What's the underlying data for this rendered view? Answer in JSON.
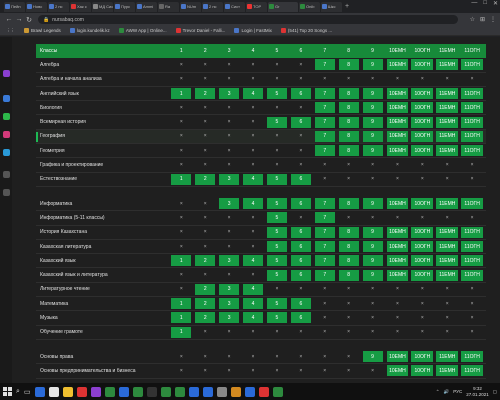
{
  "browser": {
    "tabs": [
      {
        "label": "Пейн",
        "color": "#4a76c8"
      },
      {
        "label": "Новс",
        "color": "#4a76c8"
      },
      {
        "label": "2 нс",
        "color": "#4a76c8"
      },
      {
        "label": "Хак с",
        "color": "#d33"
      },
      {
        "label": "МД Сист",
        "color": "#888"
      },
      {
        "label": "Пурс",
        "color": "#4a76c8"
      },
      {
        "label": "Ammi",
        "color": "#4a76c8"
      },
      {
        "label": "Ra",
        "color": "#666"
      },
      {
        "label": "NUm",
        "color": "#4a76c8"
      },
      {
        "label": "2 нс",
        "color": "#4a76c8"
      },
      {
        "label": "Сист",
        "color": "#4a76c8"
      },
      {
        "label": "TOP",
        "color": "#e33"
      },
      {
        "label": "Gr",
        "color": "#2d8a3e"
      },
      {
        "label": "Onib",
        "color": "#2d8a3e"
      },
      {
        "label": "Шкс",
        "color": "#4a76c8"
      }
    ],
    "active_tab": 12,
    "url": "nursabaq.com",
    "bookmarks": [
      {
        "label": "Brawl Legends",
        "color": "#c93"
      },
      {
        "label": "login.kundelik.kz",
        "color": "#4a76c8"
      },
      {
        "label": "AWW App | Online...",
        "color": "#2d8a3e"
      },
      {
        "label": "Trevor Daniel - Falli...",
        "color": "#d33"
      },
      {
        "label": "Login | FastMix",
        "color": "#4a76c8"
      },
      {
        "label": "(541) Top 20 Songs ...",
        "color": "#d33"
      }
    ]
  },
  "table": {
    "header": {
      "label": "Классы",
      "cols": [
        "1",
        "2",
        "3",
        "4",
        "5",
        "6",
        "7",
        "8",
        "9",
        "10ЕМН",
        "10ОГН",
        "11ЕМН",
        "11ОГН"
      ]
    },
    "groups": [
      {
        "rows": [
          {
            "label": "Алгебра",
            "cells": [
              "×",
              "×",
              "×",
              "×",
              "×",
              "×",
              "7",
              "8",
              "9",
              "10ЕМН",
              "10ОГН",
              "11ЕМН",
              "11ОГН"
            ]
          },
          {
            "label": "Алгебра и начала анализа",
            "cells": [
              "×",
              "×",
              "×",
              "×",
              "×",
              "×",
              "×",
              "×",
              "×",
              "×",
              "×",
              "×",
              "×"
            ]
          },
          {
            "label": "Английский язык",
            "cells": [
              "1",
              "2",
              "3",
              "4",
              "5",
              "6",
              "7",
              "8",
              "9",
              "10ЕМН",
              "10ОГН",
              "11ЕМН",
              "11ОГН"
            ]
          },
          {
            "label": "Биология",
            "cells": [
              "×",
              "×",
              "×",
              "×",
              "×",
              "×",
              "7",
              "8",
              "9",
              "10ЕМН",
              "10ОГН",
              "11ЕМН",
              "11ОГН"
            ]
          },
          {
            "label": "Всемирная история",
            "cells": [
              "×",
              "×",
              "×",
              "×",
              "5",
              "6",
              "7",
              "8",
              "9",
              "10ЕМН",
              "10ОГН",
              "11ЕМН",
              "11ОГН"
            ]
          },
          {
            "label": "География",
            "cells": [
              "×",
              "×",
              "×",
              "×",
              "×",
              "×",
              "7",
              "8",
              "9",
              "10ЕМН",
              "10ОГН",
              "11ЕМН",
              "11ОГН"
            ]
          },
          {
            "label": "Геометрия",
            "cells": [
              "×",
              "×",
              "×",
              "×",
              "×",
              "×",
              "7",
              "8",
              "9",
              "10ЕМН",
              "10ОГН",
              "11ЕМН",
              "11ОГН"
            ]
          },
          {
            "label": "Графика и проектирование",
            "cells": [
              "×",
              "×",
              "×",
              "×",
              "×",
              "×",
              "×",
              "×",
              "×",
              "×",
              "×",
              "×",
              "×"
            ]
          },
          {
            "label": "Естествознание",
            "cells": [
              "1",
              "2",
              "3",
              "4",
              "5",
              "6",
              "×",
              "×",
              "×",
              "×",
              "×",
              "×",
              "×"
            ]
          }
        ]
      },
      {
        "rows": [
          {
            "label": "Информатика",
            "cells": [
              "×",
              "×",
              "3",
              "4",
              "5",
              "6",
              "7",
              "8",
              "9",
              "10ЕМН",
              "10ОГН",
              "11ЕМН",
              "11ОГН"
            ]
          },
          {
            "label": "Информатика (5-11 классы)",
            "cells": [
              "×",
              "×",
              "×",
              "×",
              "5",
              "×",
              "7",
              "×",
              "×",
              "×",
              "×",
              "×",
              "×"
            ]
          },
          {
            "label": "История Казахстана",
            "cells": [
              "×",
              "×",
              "×",
              "×",
              "5",
              "6",
              "7",
              "8",
              "9",
              "10ЕМН",
              "10ОГН",
              "11ЕМН",
              "11ОГН"
            ]
          },
          {
            "label": "Казахская литература",
            "cells": [
              "×",
              "×",
              "×",
              "×",
              "5",
              "6",
              "7",
              "8",
              "9",
              "10ЕМН",
              "10ОГН",
              "11ЕМН",
              "11ОГН"
            ]
          },
          {
            "label": "Казахский язык",
            "cells": [
              "1",
              "2",
              "3",
              "4",
              "5",
              "6",
              "7",
              "8",
              "9",
              "10ЕМН",
              "10ОГН",
              "11ЕМН",
              "11ОГН"
            ]
          },
          {
            "label": "Казахский язык и литература",
            "cells": [
              "×",
              "×",
              "×",
              "×",
              "5",
              "6",
              "7",
              "8",
              "9",
              "10ЕМН",
              "10ОГН",
              "11ЕМН",
              "11ОГН"
            ]
          },
          {
            "label": "Литературное чтение",
            "cells": [
              "×",
              "2",
              "3",
              "4",
              "×",
              "×",
              "×",
              "×",
              "×",
              "×",
              "×",
              "×",
              "×"
            ]
          },
          {
            "label": "Математика",
            "cells": [
              "1",
              "2",
              "3",
              "4",
              "5",
              "6",
              "×",
              "×",
              "×",
              "×",
              "×",
              "×",
              "×"
            ]
          },
          {
            "label": "Музыка",
            "cells": [
              "1",
              "2",
              "3",
              "4",
              "5",
              "6",
              "×",
              "×",
              "×",
              "×",
              "×",
              "×",
              "×"
            ]
          },
          {
            "label": "Обучение грамоте",
            "cells": [
              "1",
              "×",
              "×",
              "×",
              "×",
              "×",
              "×",
              "×",
              "×",
              "×",
              "×",
              "×",
              "×"
            ]
          }
        ]
      },
      {
        "rows": [
          {
            "label": "Основы права",
            "cells": [
              "×",
              "×",
              "×",
              "×",
              "×",
              "×",
              "×",
              "×",
              "9",
              "10ЕМН",
              "10ОГН",
              "11ЕМН",
              "11ОГН"
            ]
          },
          {
            "label": "Основы предпринимательства и бизнеса",
            "cells": [
              "×",
              "×",
              "×",
              "×",
              "×",
              "×",
              "×",
              "×",
              "×",
              "10ЕМН",
              "10ОГН",
              "11ЕМН",
              "11ОГН"
            ]
          }
        ]
      }
    ],
    "highlighted_row": "География"
  },
  "taskbar": {
    "icons": [
      "#2a6ad8",
      "#e6e6e6",
      "#f0c030",
      "#d33",
      "#8c3fd0",
      "#2d8a3e",
      "#2a6ad8",
      "#2d8a3e",
      "#333",
      "#2d8a3e",
      "#2d8a3e",
      "#2a6ad8",
      "#2a6ad8",
      "#888",
      "#d38a20",
      "#2a6ad8",
      "#d33",
      "#2d8a3e"
    ],
    "lang": "РУС",
    "time": "9:32",
    "date": "27.01.2021"
  }
}
